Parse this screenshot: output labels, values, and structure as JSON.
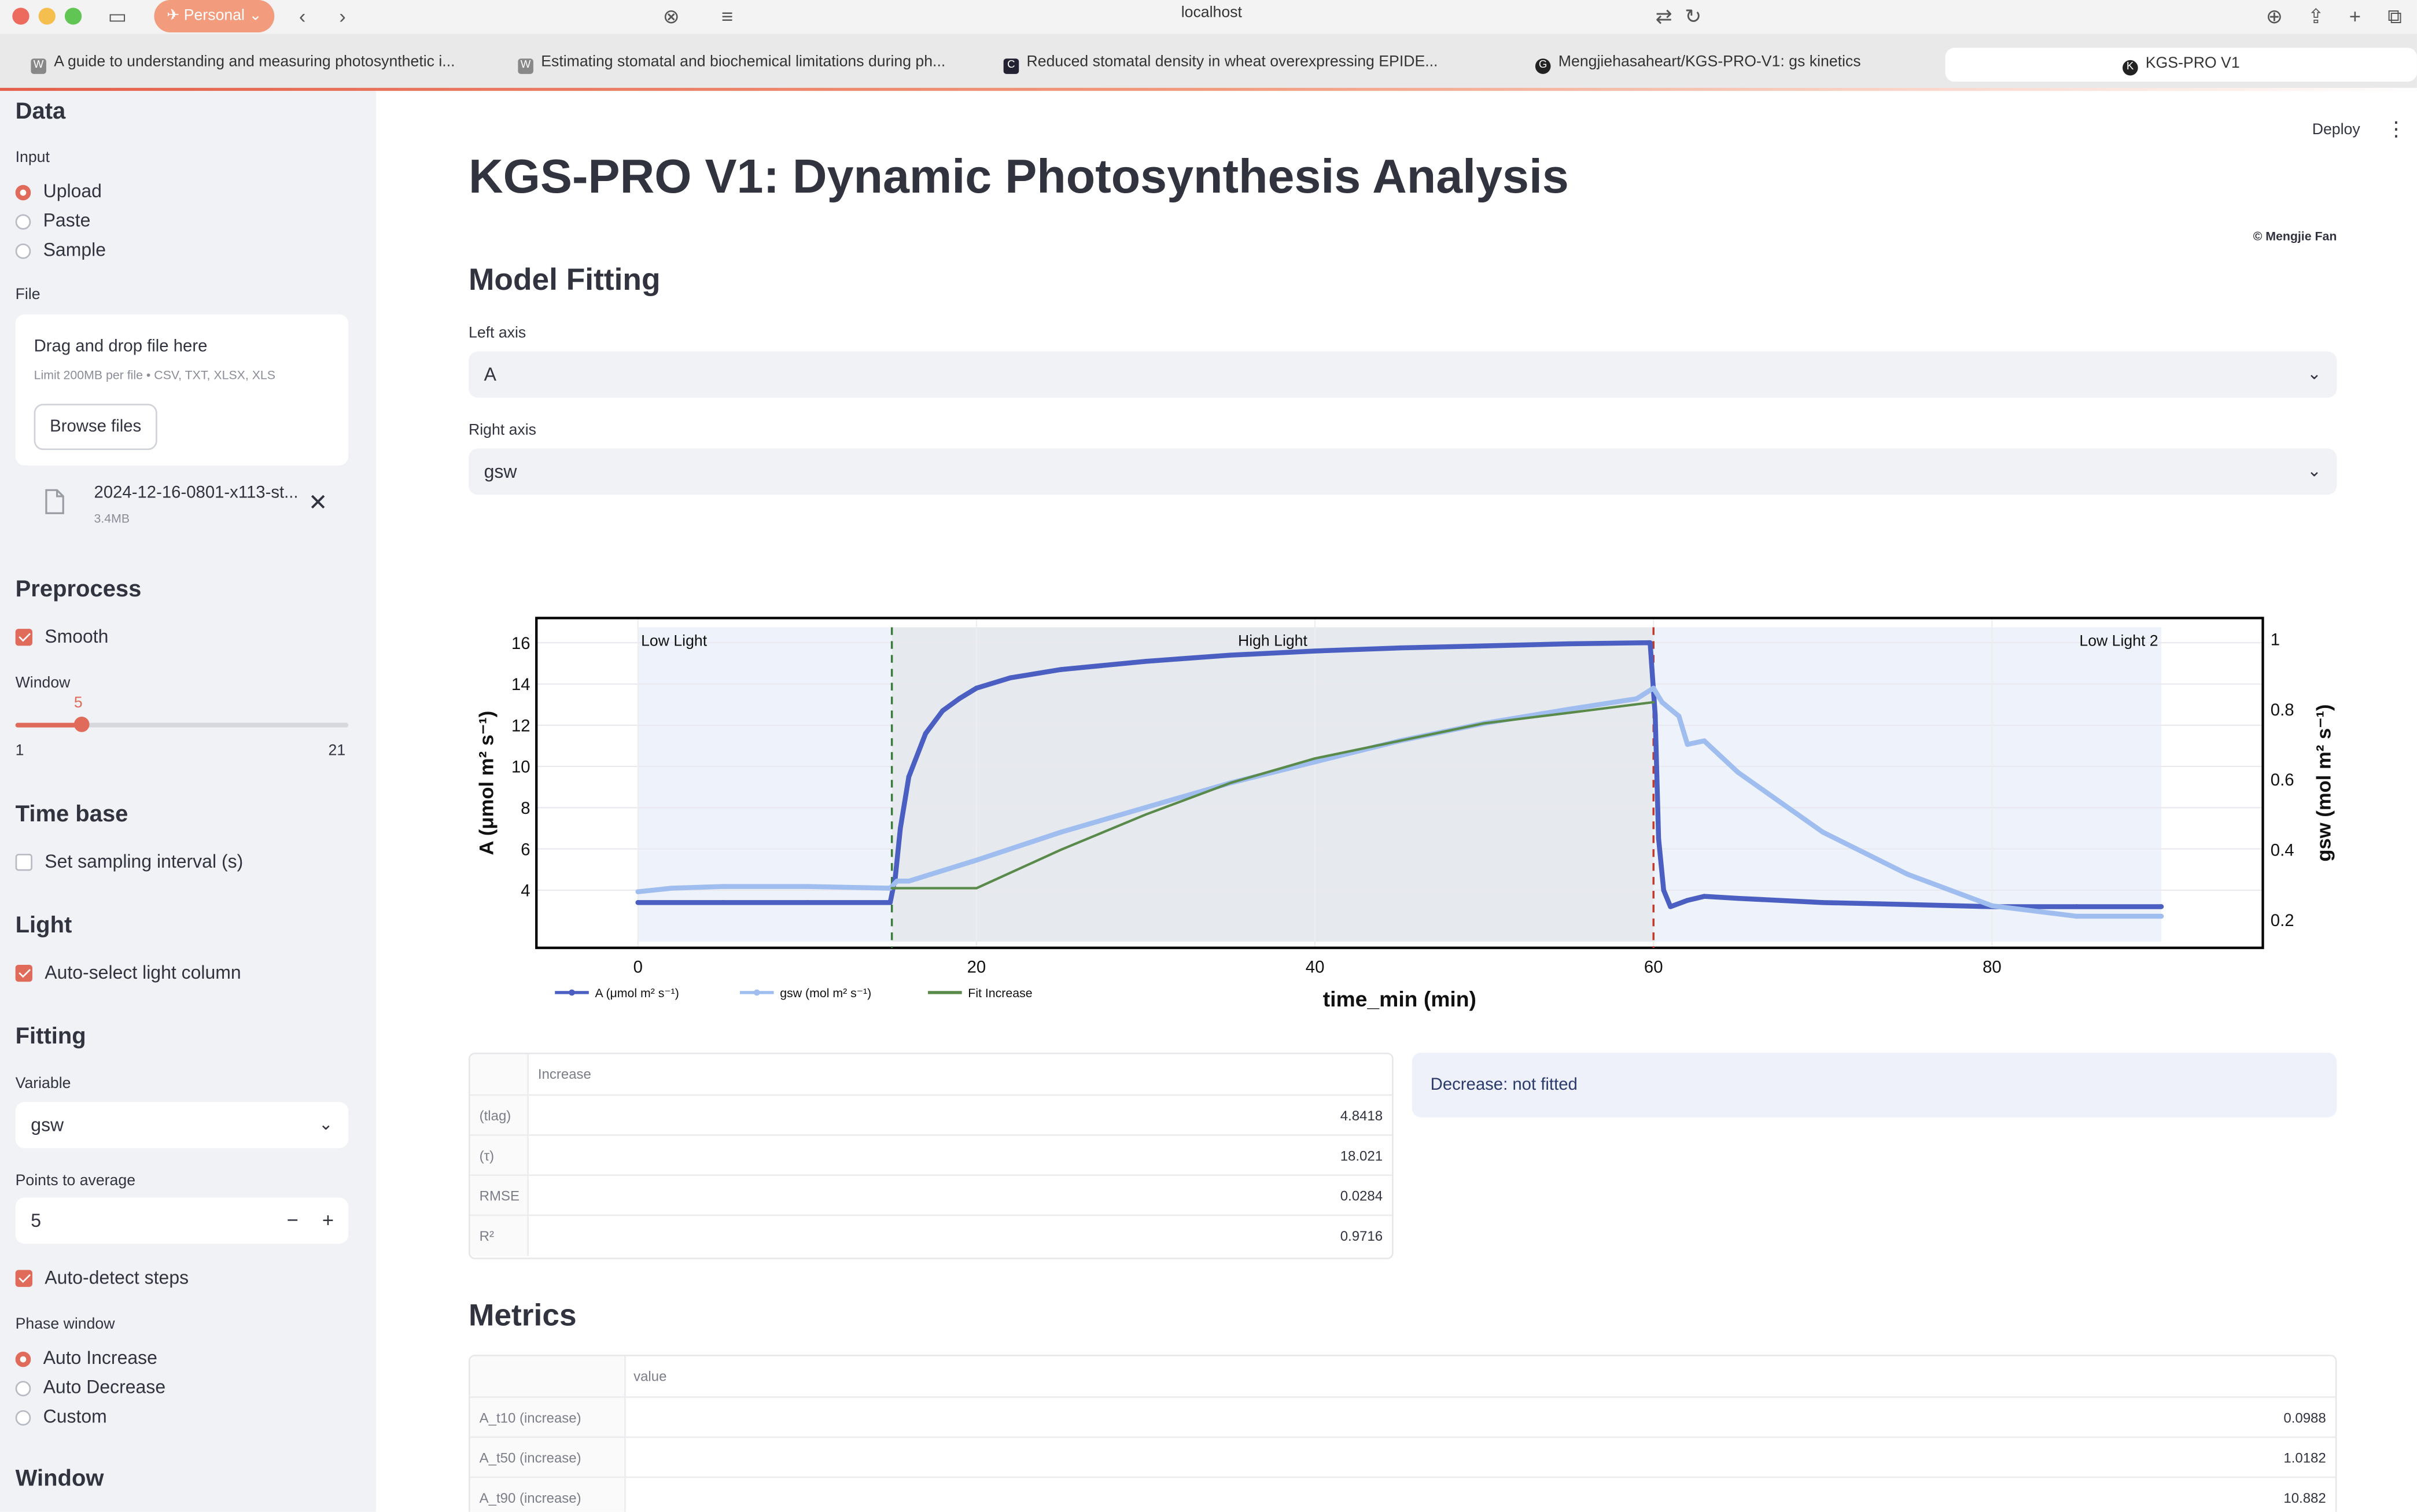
{
  "browser": {
    "profile_label": "Personal",
    "url": "localhost",
    "tabs": [
      {
        "label": "A guide to understanding and measuring photosynthetic i...",
        "fav": "W"
      },
      {
        "label": "Estimating stomatal and biochemical limitations during ph...",
        "fav": "W"
      },
      {
        "label": "Reduced stomatal density in wheat overexpressing EPIDE...",
        "fav": "C"
      },
      {
        "label": "Mengjiehasaheart/KGS-PRO-V1: gs kinetics",
        "fav": "G"
      },
      {
        "label": "KGS-PRO V1",
        "fav": "K"
      }
    ]
  },
  "sidebar": {
    "data_heading": "Data",
    "input_label": "Input",
    "input_options": [
      "Upload",
      "Paste",
      "Sample"
    ],
    "input_selected": "Upload",
    "file_label": "File",
    "dropzone_title": "Drag and drop file here",
    "dropzone_sub": "Limit 200MB per file • CSV, TXT, XLSX, XLS",
    "browse_label": "Browse files",
    "file_name": "2024-12-16-0801-x113-st...",
    "file_size": "3.4MB",
    "preprocess_heading": "Preprocess",
    "smooth_label": "Smooth",
    "smooth_checked": true,
    "window_label": "Window",
    "window_value": "5",
    "window_min": "1",
    "window_max": "21",
    "window_fraction": 0.2,
    "timebase_heading": "Time base",
    "sampling_label": "Set sampling interval (s)",
    "sampling_checked": false,
    "light_heading": "Light",
    "autolight_label": "Auto-select light column",
    "autolight_checked": true,
    "fitting_heading": "Fitting",
    "variable_label": "Variable",
    "variable_value": "gsw",
    "points_label": "Points to average",
    "points_value": "5",
    "minus": "−",
    "plus": "+",
    "autosteps_label": "Auto-detect steps",
    "autosteps_checked": true,
    "phase_label": "Phase window",
    "phase_options": [
      "Auto Increase",
      "Auto Decrease",
      "Custom"
    ],
    "phase_selected": "Auto Increase",
    "window_heading": "Window"
  },
  "header": {
    "deploy_label": "Deploy",
    "menu_glyph": "⋮"
  },
  "main": {
    "title": "KGS-PRO V1: Dynamic Photosynthesis Analysis",
    "credit": "© Mengjie Fan",
    "model_fitting_heading": "Model Fitting",
    "left_axis_label": "Left axis",
    "left_axis_value": "A",
    "right_axis_label": "Right axis",
    "right_axis_value": "gsw",
    "fit_table": {
      "column": "Increase",
      "rows": [
        {
          "name": "(tlag)",
          "value": "4.8418"
        },
        {
          "name": "(τ)",
          "value": "18.021"
        },
        {
          "name": "RMSE",
          "value": "0.0284"
        },
        {
          "name": "R²",
          "value": "0.9716"
        }
      ]
    },
    "decrease_note": "Decrease: not fitted",
    "metrics_heading": "Metrics",
    "metrics_table": {
      "column": "value",
      "rows": [
        {
          "name": "A_t10 (increase)",
          "value": "0.0988"
        },
        {
          "name": "A_t50 (increase)",
          "value": "1.0182"
        },
        {
          "name": "A_t90 (increase)",
          "value": "10.882"
        }
      ]
    }
  },
  "chart_data": {
    "type": "line",
    "xlabel": "time_min (min)",
    "ylabel_left": "A (μmol m² s⁻¹)",
    "ylabel_right": "gsw (mol m² s⁻¹)",
    "xlim": [
      -6,
      96
    ],
    "xticks": [
      0,
      20,
      40,
      60,
      80
    ],
    "ylim_left": [
      1.2,
      17.2
    ],
    "yticks_left": [
      4,
      6,
      8,
      10,
      12,
      14,
      16
    ],
    "ylim_right": [
      0.12,
      1.06
    ],
    "yticks_right": [
      0.2,
      0.4,
      0.6,
      0.8,
      1
    ],
    "phases": [
      {
        "label": "Low Light",
        "x0": 0,
        "x1": 15
      },
      {
        "label": "High Light",
        "x0": 15,
        "x1": 60
      },
      {
        "label": "Low Light 2",
        "x0": 60,
        "x1": 90
      }
    ],
    "step_lines": [
      {
        "x": 15,
        "color": "#3a7a3a"
      },
      {
        "x": 60,
        "color": "#c0392b"
      }
    ],
    "series": [
      {
        "name": "A (μmol m² s⁻¹)",
        "axis": "left",
        "color": "#4a5fc1",
        "x": [
          0,
          5,
          10,
          14.9,
          15.2,
          15.5,
          16,
          17,
          18,
          19,
          20,
          22,
          25,
          30,
          35,
          40,
          45,
          50,
          55,
          59.8,
          60.1,
          60.3,
          60.6,
          61,
          62,
          63,
          65,
          70,
          75,
          80,
          85,
          90
        ],
        "y": [
          3.4,
          3.4,
          3.4,
          3.4,
          4.6,
          7.0,
          9.5,
          11.6,
          12.7,
          13.3,
          13.8,
          14.3,
          14.7,
          15.1,
          15.4,
          15.6,
          15.75,
          15.85,
          15.95,
          16.0,
          12.5,
          6.5,
          4.0,
          3.2,
          3.5,
          3.7,
          3.6,
          3.4,
          3.3,
          3.2,
          3.2,
          3.2
        ]
      },
      {
        "name": "gsw (mol m² s⁻¹)",
        "axis": "left_scaled_right",
        "color": "#9fbdef",
        "x": [
          0,
          2,
          5,
          10,
          14.9,
          15.3,
          16,
          18,
          20,
          25,
          30,
          35,
          40,
          45,
          50,
          55,
          59,
          60,
          60.5,
          61.5,
          62,
          63,
          65,
          70,
          75,
          80,
          85,
          90
        ],
        "y": [
          0.28,
          0.29,
          0.295,
          0.295,
          0.29,
          0.31,
          0.31,
          0.34,
          0.37,
          0.45,
          0.52,
          0.59,
          0.65,
          0.71,
          0.76,
          0.8,
          0.83,
          0.86,
          0.82,
          0.78,
          0.7,
          0.71,
          0.62,
          0.45,
          0.33,
          0.24,
          0.21,
          0.21
        ]
      },
      {
        "name": "Fit Increase",
        "axis": "right",
        "color": "#5a8a4a",
        "x": [
          15,
          20,
          25,
          30,
          35,
          40,
          45,
          50,
          55,
          60
        ],
        "y": [
          0.29,
          0.29,
          0.4,
          0.5,
          0.59,
          0.66,
          0.71,
          0.76,
          0.79,
          0.82
        ]
      }
    ]
  }
}
